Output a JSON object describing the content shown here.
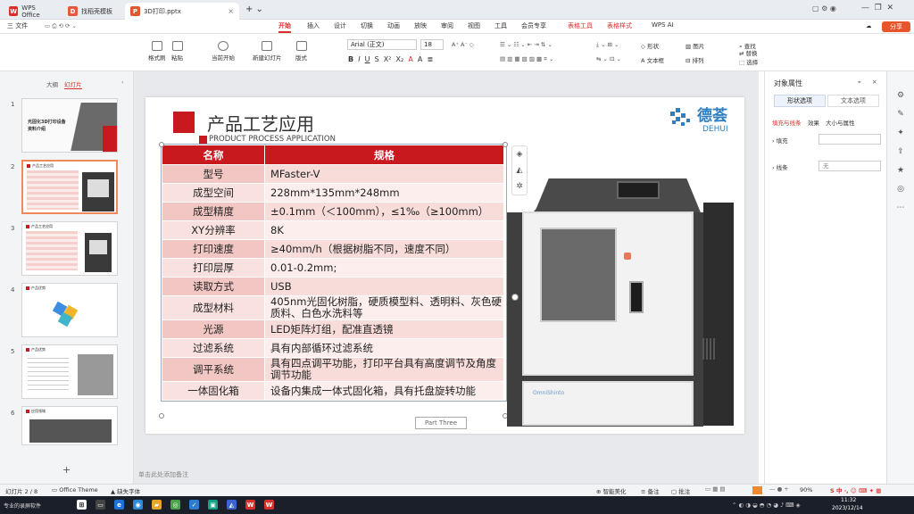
{
  "tabs": [
    {
      "label": "WPS Office",
      "icon": "wps-logo-icon",
      "active": false
    },
    {
      "label": "找稻壳模板",
      "icon": "docer-icon",
      "active": false
    },
    {
      "label": "3D打印.pptx",
      "active": true
    }
  ],
  "menus": [
    "三 文件",
    "开始",
    "插入",
    "设计",
    "切换",
    "动画",
    "放映",
    "审阅",
    "视图",
    "工具",
    "会员专享",
    "表格工具",
    "表格样式",
    "WPS AI"
  ],
  "share_label": "分享",
  "ribbon": {
    "format_painter": "格式刷",
    "paste": "粘贴",
    "from_current": "当前开始",
    "new_slide": "新建幻灯片",
    "layout": "版式",
    "font_name": "Arial (正文)",
    "font_size": "18",
    "shape": "形状",
    "picture": "图片",
    "textbox": "文本框",
    "arrange": "排列",
    "find": "查找",
    "replace": "替换",
    "select": "选择"
  },
  "left": {
    "tab_outline": "大纲",
    "tab_slides": "幻灯片",
    "add": "+",
    "thumbs": [
      {
        "num": "1",
        "title": "光固化3D打印设备",
        "sub": "资料介绍"
      },
      {
        "num": "2",
        "title": "产品工艺应用",
        "selected": true
      },
      {
        "num": "3",
        "title": "产品工艺应用"
      },
      {
        "num": "4",
        "title": "产品优势"
      },
      {
        "num": "5",
        "title": "产品优势"
      },
      {
        "num": "6",
        "title": "应用领域"
      }
    ]
  },
  "slide": {
    "title": "产品工艺应用",
    "subtitle": "PRODUCT PROCESS APPLICATION",
    "logo_cn": "德荟",
    "logo_en": "DEHUI",
    "table": {
      "headers": [
        "名称",
        "规格"
      ],
      "rows": [
        {
          "k": "型号",
          "v": "MFaster-V"
        },
        {
          "k": "成型空间",
          "v": "228mm*135mm*248mm"
        },
        {
          "k": "成型精度",
          "v": "±0.1mm（＜100mm），≤1‰（≥100mm）"
        },
        {
          "k": "XY分辨率",
          "v": "8K"
        },
        {
          "k": "打印速度",
          "v": "≥40mm/h（根据树脂不同，速度不同）"
        },
        {
          "k": "打印层厚",
          "v": "0.01-0.2mm;"
        },
        {
          "k": "读取方式",
          "v": "USB"
        },
        {
          "k": "成型材料",
          "v": "405nm光固化树脂，硬质模型料、透明料、灰色硬质料、白色水洗料等",
          "tall": true
        },
        {
          "k": "光源",
          "v": "LED矩阵灯组，配准直透镜"
        },
        {
          "k": "过滤系统",
          "v": "具有内部循环过滤系统"
        },
        {
          "k": "调平系统",
          "v": "具有四点调平功能，打印平台具有高度调节及角度调节功能",
          "tall": true
        },
        {
          "k": "一体固化箱",
          "v": "设备内集成一体式固化箱，具有托盘旋转功能"
        }
      ]
    },
    "part_label": "Part Three",
    "machine_brand": "OmniShinto"
  },
  "notes_placeholder": "单击此处添加备注",
  "right": {
    "title": "对象属性",
    "tab_shape": "形状选项",
    "tab_text": "文本选项",
    "sub_fill_line": "填充与线条",
    "sub_effect": "效果",
    "sub_size": "大小与属性",
    "fill_label": "填充",
    "line_label": "线条",
    "line_value": "无"
  },
  "status": {
    "page": "幻灯片 2 / 8",
    "theme": "Office Theme",
    "font_missing": "缺失字体",
    "smart": "智能美化",
    "notes": "备注",
    "comment": "批注",
    "zoom": "90%"
  },
  "taskbar": {
    "time": "11:32",
    "date": "2023/12/14",
    "label": "专业的录屏软件"
  },
  "colors": {
    "accent": "#d9302c",
    "table_header": "#c8191e",
    "title_square": "#c8191e"
  }
}
